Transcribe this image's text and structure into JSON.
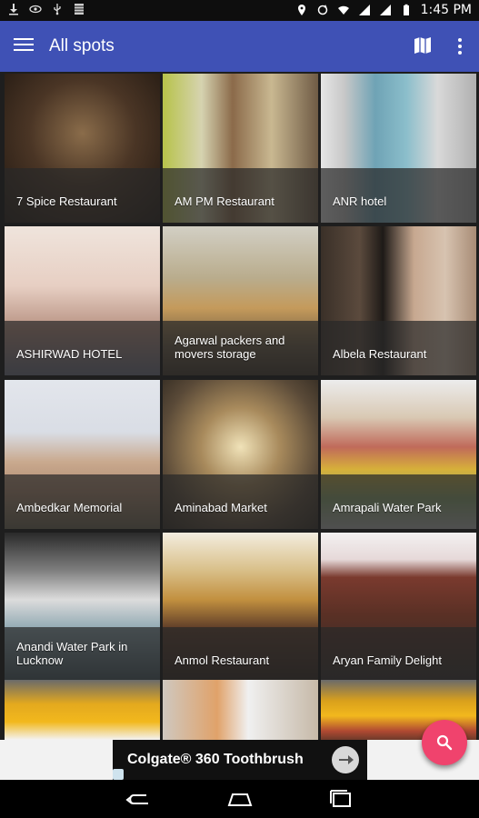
{
  "status_bar": {
    "time": "1:45 PM",
    "left_icons": [
      "download-icon",
      "visibility-icon",
      "usb-icon",
      "stack-icon"
    ],
    "right_icons": [
      "location-icon",
      "sync-icon",
      "wifi-icon",
      "signal-icon",
      "signal-icon",
      "battery-icon"
    ]
  },
  "app_bar": {
    "title": "All spots",
    "color": "#3f51b5",
    "icons": [
      "menu-icon",
      "map-icon",
      "more-vert-icon"
    ]
  },
  "spots": [
    {
      "name": "7 Spice Restaurant"
    },
    {
      "name": "AM PM Restaurant"
    },
    {
      "name": "ANR hotel"
    },
    {
      "name": "ASHIRWAD HOTEL"
    },
    {
      "name": "Agarwal packers and movers storage"
    },
    {
      "name": "Albela Restaurant"
    },
    {
      "name": "Ambedkar Memorial"
    },
    {
      "name": "Aminabad Market"
    },
    {
      "name": "Amrapali Water Park"
    },
    {
      "name": "Anandi Water Park in Lucknow"
    },
    {
      "name": "Anmol Restaurant"
    },
    {
      "name": "Aryan Family Delight"
    },
    {
      "name": ""
    },
    {
      "name": ""
    },
    {
      "name": ""
    }
  ],
  "fab": {
    "icon": "search-icon",
    "color": "#f0436d"
  },
  "ad": {
    "text": "Colgate® 360 Toothbrush",
    "icon": "arrow-forward-icon"
  },
  "nav_bar": {
    "icons": [
      "back-icon",
      "home-icon",
      "recents-icon"
    ]
  }
}
